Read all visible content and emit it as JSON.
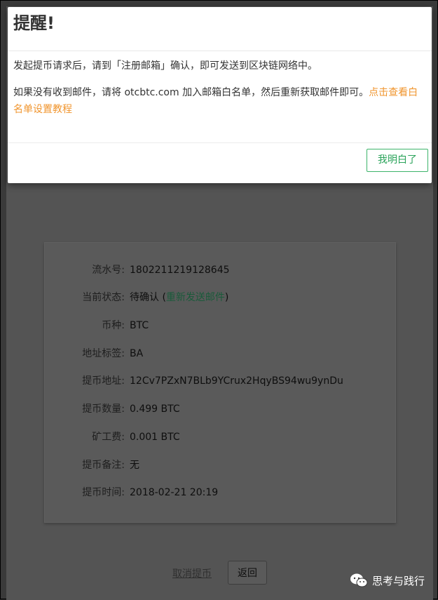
{
  "modal": {
    "title": "提醒!",
    "line1": "发起提币请求后，请到「注册邮箱」确认，即可发送到区块链网络中。",
    "line2_text": "如果没有收到邮件，请将 otcbtc.com 加入邮箱白名单，然后重新获取邮件即可。",
    "line2_link": "点击查看白名单设置教程",
    "ok_label": "我明白了"
  },
  "details": {
    "rows": [
      {
        "label": "流水号:",
        "value": "1802211219128645"
      },
      {
        "label": "当前状态:",
        "value": "待确认 (",
        "link": "重新发送邮件",
        "suffix": ")"
      },
      {
        "label": "币种:",
        "value": "BTC"
      },
      {
        "label": "地址标签:",
        "value": "BA"
      },
      {
        "label": "提币地址:",
        "value": "12Cv7PZxN7BLb9YCrux2HqyBS94wu9ynDu"
      },
      {
        "label": "提币数量:",
        "value": "0.499 BTC"
      },
      {
        "label": "矿工费:",
        "value": "0.001 BTC"
      },
      {
        "label": "提币备注:",
        "value": "无"
      },
      {
        "label": "提币时间:",
        "value": "2018-02-21 20:19"
      }
    ]
  },
  "actions": {
    "cancel_label": "取消提币",
    "back_label": "返回"
  },
  "watermark": {
    "text": "思考与践行",
    "icon": "wechat-icon"
  },
  "colors": {
    "accent_green": "#2aa35a",
    "link_orange": "#f0952e"
  }
}
